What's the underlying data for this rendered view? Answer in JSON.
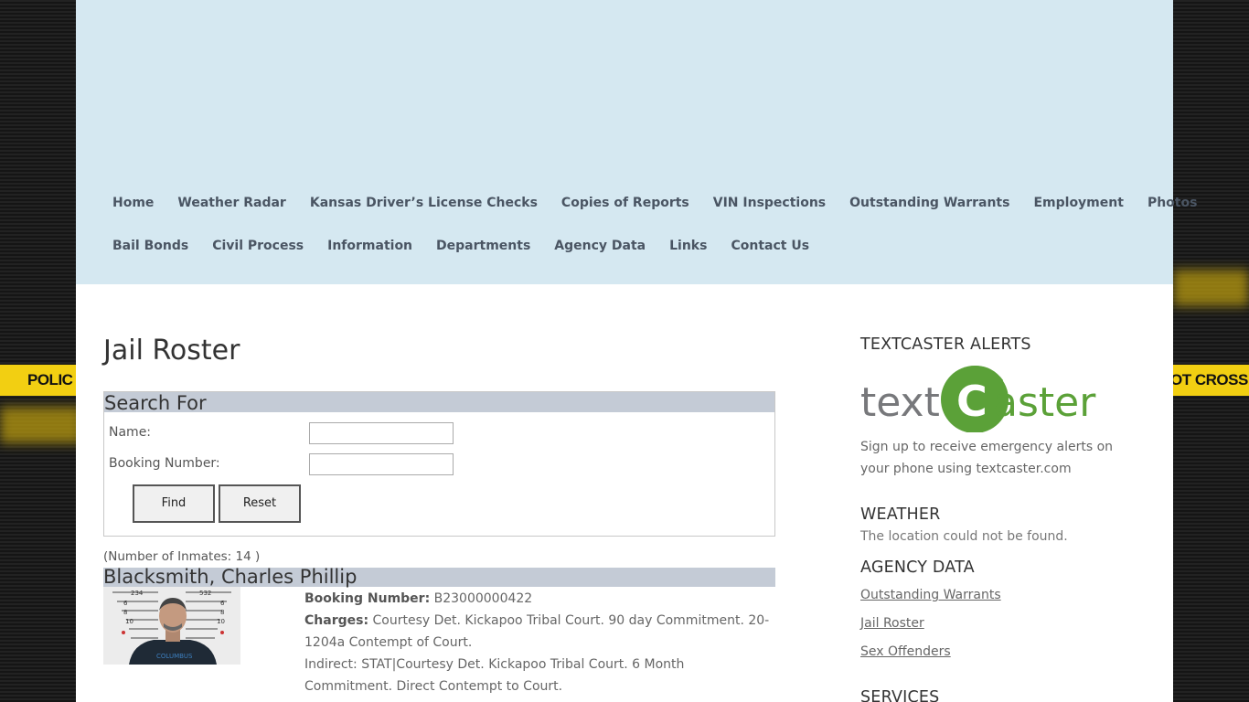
{
  "background": {
    "tape_left": "POLIC",
    "tape_right": "OT CROSS",
    "tape_color": "#f2cf12"
  },
  "nav": {
    "row1": [
      "Home",
      "Weather Radar",
      "Kansas Driver’s License Checks",
      "Copies of Reports",
      "VIN Inspections",
      "Outstanding Warrants",
      "Employment",
      "Photos"
    ],
    "row2": [
      "Bail Bonds",
      "Civil Process",
      "Information",
      "Departments",
      "Agency Data",
      "Links",
      "Contact Us"
    ]
  },
  "main": {
    "title": "Jail Roster",
    "search": {
      "heading": "Search For",
      "name_label": "Name:",
      "name_value": "",
      "booking_label": "Booking Number:",
      "booking_value": "",
      "find_label": "Find",
      "reset_label": "Reset"
    },
    "count": "(Number of Inmates: 14 )",
    "inmate": {
      "name": "Blacksmith, Charles Phillip",
      "booking_label": "Booking Number:",
      "booking_value": "B23000000422",
      "charges_label": "Charges:",
      "charges_line1": "Courtesy Det. Kickapoo Tribal Court. 90 day Commitment. 20-1204a Contempt of Court.",
      "charges_line2": "Indirect: STAT|Courtesy Det. Kickapoo Tribal Court. 6 Month Commitment. Direct Contempt to Court."
    }
  },
  "sidebar": {
    "textcaster": {
      "title": "TEXTCASTER ALERTS",
      "logo_left": "text",
      "logo_c": "C",
      "logo_right": "aster",
      "description": "Sign up to receive emergency alerts on your phone using textcaster.com",
      "logo_color": "#5ba138",
      "logo_text_color": "#77787b"
    },
    "weather": {
      "title": "WEATHER",
      "message": "The location could not be found."
    },
    "agency": {
      "title": "AGENCY DATA",
      "links": [
        "Outstanding Warrants",
        "Jail Roster",
        "Sex Offenders"
      ]
    },
    "services": {
      "title": "SERVICES"
    }
  }
}
